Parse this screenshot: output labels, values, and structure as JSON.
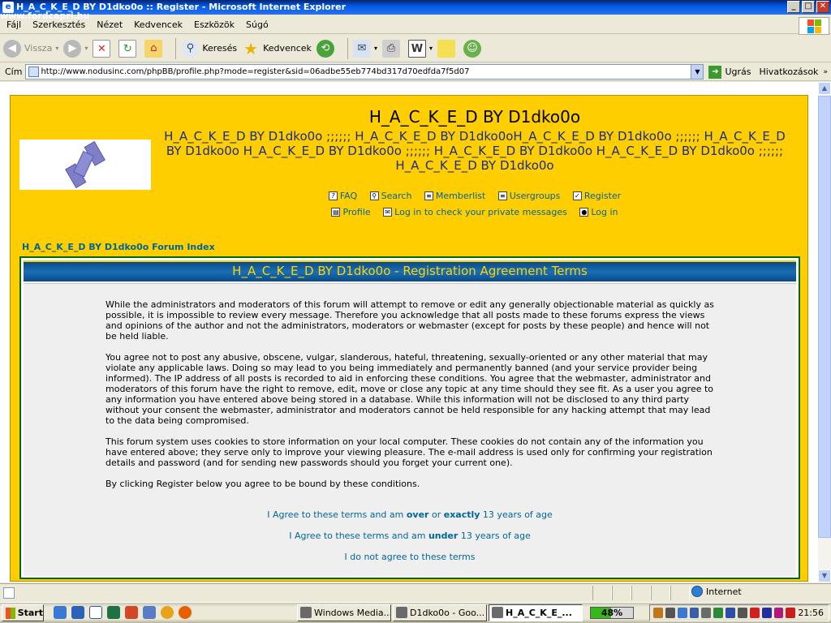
{
  "window": {
    "title": "H_A_C_K_E_D BY D1dko0o :: Register - Microsoft Internet Explorer",
    "watermark": "www.fordcapri.hu"
  },
  "menu": [
    "Fájl",
    "Szerkesztés",
    "Nézet",
    "Kedvencek",
    "Eszközök",
    "Súgó"
  ],
  "toolbar": {
    "back": "Vissza",
    "search": "Keresés",
    "favorites": "Kedvencek"
  },
  "address": {
    "label": "Cím",
    "url": "http://www.nodusinc.com/phpBB/profile.php?mode=register&sid=06adbe55eb774bd317d70edfda7f5d07",
    "go": "Ugrás",
    "links": "Hivatkozások"
  },
  "forum": {
    "site_title": "H_A_C_K_E_D BY D1dko0o",
    "site_desc": "H_A_C_K_E_D BY D1dko0o ;;;;;; H_A_C_K_E_D BY D1dko0oH_A_C_K_E_D BY D1dko0o ;;;;;; H_A_C_K_E_D BY D1dko0o H_A_C_K_E_D BY D1dko0o ;;;;;; H_A_C_K_E_D BY D1dko0o H_A_C_K_E_D BY D1dko0o ;;;;;; H_A_C_K_E_D BY D1dko0o",
    "nav1": [
      "FAQ",
      "Search",
      "Memberlist",
      "Usergroups",
      "Register"
    ],
    "nav2": [
      "Profile",
      "Log in to check your private messages",
      "Log in"
    ],
    "index_link": "H_A_C_K_E_D BY D1dko0o Forum Index",
    "box_title": "H_A_C_K_E_D BY D1dko0o - Registration Agreement Terms",
    "terms": [
      "While the administrators and moderators of this forum will attempt to remove or edit any generally objectionable material as quickly as possible, it is impossible to review every message. Therefore you acknowledge that all posts made to these forums express the views and opinions of the author and not the administrators, moderators or webmaster (except for posts by these people) and hence will not be held liable.",
      "You agree not to post any abusive, obscene, vulgar, slanderous, hateful, threatening, sexually-oriented or any other material that may violate any applicable laws. Doing so may lead to you being immediately and permanently banned (and your service provider being informed). The IP address of all posts is recorded to aid in enforcing these conditions. You agree that the webmaster, administrator and moderators of this forum have the right to remove, edit, move or close any topic at any time should they see fit. As a user you agree to any information you have entered above being stored in a database. While this information will not be disclosed to any third party without your consent the webmaster, administrator and moderators cannot be held responsible for any hacking attempt that may lead to the data being compromised.",
      "This forum system uses cookies to store information on your local computer. These cookies do not contain any of the information you have entered above; they serve only to improve your viewing pleasure. The e-mail address is used only for confirming your registration details and password (and for sending new passwords should you forget your current one).",
      "By clicking Register below you agree to be bound by these conditions."
    ],
    "agree_over": {
      "a": "I Agree to these terms and am ",
      "b": "over",
      "c": " or ",
      "d": "exactly",
      "e": " 13 years of age"
    },
    "agree_under": {
      "a": "I Agree to these terms and am ",
      "b": "under",
      "c": " 13 years of age"
    },
    "disagree": "I do not agree to these terms"
  },
  "status": {
    "zone": "Internet"
  },
  "taskbar": {
    "start": "Start",
    "tasks": [
      "Windows Media...",
      "D1dko0o - Goo...",
      "H_A_C_K_E_..."
    ],
    "battery": "48%",
    "clock": "21:56"
  },
  "colors": {
    "page_bg": "#fece00",
    "link": "#006699",
    "header_bar": "#1a6fb3"
  }
}
